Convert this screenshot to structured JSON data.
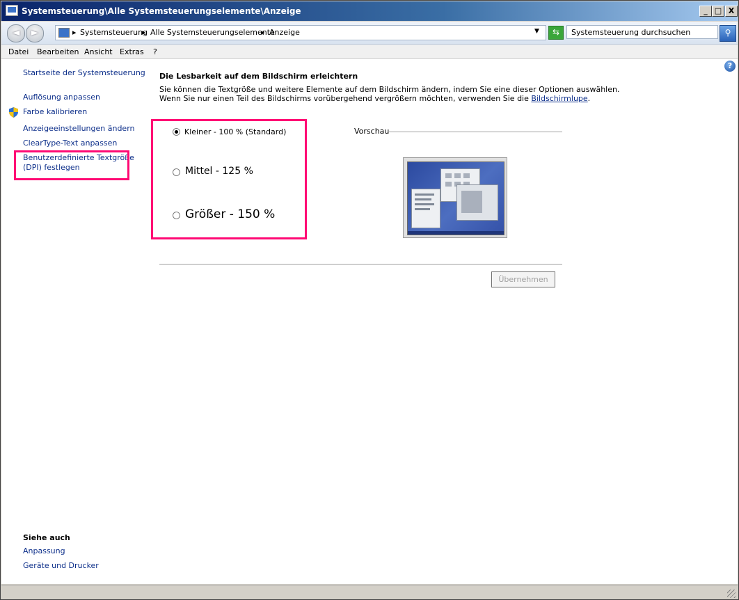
{
  "window": {
    "title": "Systemsteuerung\\Alle Systemsteuerungselemente\\Anzeige",
    "minimize": "_",
    "maximize": "□",
    "close": "X"
  },
  "navbar": {
    "back": "◄",
    "forward": "►",
    "breadcrumbs": [
      "Systemsteuerung",
      "Alle Systemsteuerungselemente",
      "Anzeige"
    ],
    "search_placeholder": "Systemsteuerung durchsuchen"
  },
  "menu": [
    "Datei",
    "Bearbeiten",
    "Ansicht",
    "Extras",
    "?"
  ],
  "sidebar": {
    "items": [
      {
        "label": "Startseite der Systemsteuerung"
      },
      {
        "label": "Auflösung anpassen"
      },
      {
        "label": "Farbe kalibrieren"
      },
      {
        "label": "Anzeigeeinstellungen ändern"
      },
      {
        "label": "ClearType-Text anpassen"
      },
      {
        "label_line1": "Benutzerdefinierte Textgröße",
        "label_line2": "(DPI) festlegen"
      }
    ],
    "see_also_heading": "Siehe auch",
    "see_also": [
      "Anpassung",
      "Geräte und Drucker"
    ]
  },
  "main": {
    "heading": "Die Lesbarkeit auf dem Bildschirm erleichtern",
    "desc_line1": "Sie können die Textgröße und weitere Elemente auf dem Bildschirm ändern, indem Sie eine dieser Optionen auswählen.",
    "desc_line2_prefix": "Wenn Sie nur einen Teil des Bildschirms vorübergehend vergrößern möchten, verwenden Sie die ",
    "desc_line2_link": "Bildschirmlupe",
    "desc_line2_suffix": ".",
    "options": [
      {
        "label": "Kleiner - 100 % (Standard)",
        "checked": true
      },
      {
        "label": "Mittel - 125 %",
        "checked": false
      },
      {
        "label": "Größer - 150 %",
        "checked": false
      }
    ],
    "preview_label": "Vorschau",
    "apply_button": "Übernehmen"
  },
  "help": "?",
  "colors": {
    "highlight": "#ff0a74",
    "link": "#0d2f8a"
  }
}
